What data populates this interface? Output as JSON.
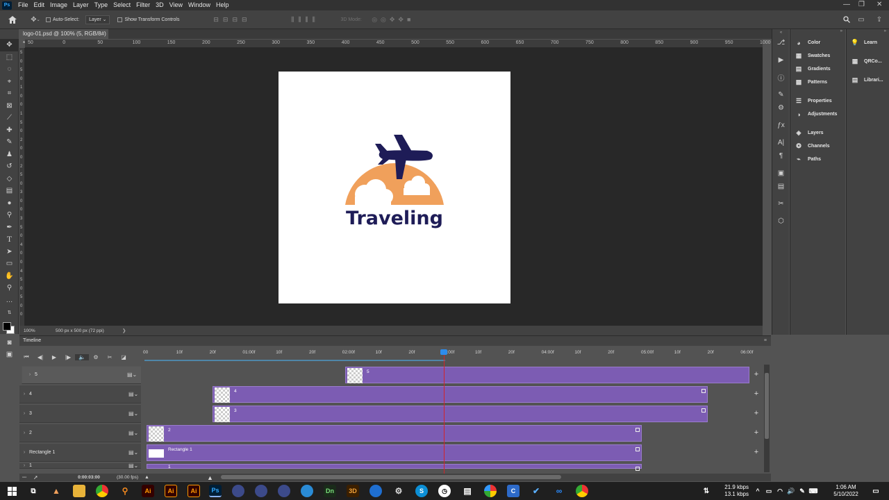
{
  "app": {
    "logo": "Ps",
    "accent": "#31a8ff"
  },
  "menubar": {
    "items": [
      "File",
      "Edit",
      "Image",
      "Layer",
      "Type",
      "Select",
      "Filter",
      "3D",
      "View",
      "Window",
      "Help"
    ],
    "window_controls": [
      "—",
      "❐",
      "✕"
    ]
  },
  "options_bar": {
    "auto_select_label": "Auto-Select:",
    "auto_select_value": "Layer",
    "show_transform_label": "Show Transform Controls",
    "mode_3d_label": "3D Mode:"
  },
  "document": {
    "tab_title": "logo-01.psd @ 100% (5, RGB/8#) *",
    "close_symbol": "×",
    "zoom": "100%",
    "size_info": "500 px x 500 px (72 ppi)",
    "status_arrow": "❯"
  },
  "ruler": {
    "h_labels": [
      "50",
      "0",
      "50",
      "100",
      "150",
      "200",
      "250",
      "300",
      "350",
      "400",
      "450",
      "500",
      "550",
      "600",
      "650",
      "700",
      "750",
      "800",
      "850",
      "900",
      "950",
      "1000"
    ],
    "v_labels": [
      "5",
      "0",
      "5",
      "0",
      "1",
      "0",
      "0",
      "1",
      "5",
      "0",
      "2",
      "0",
      "0",
      "2",
      "5",
      "0",
      "3",
      "0",
      "0",
      "3",
      "5",
      "0",
      "4",
      "0",
      "0",
      "4",
      "5",
      "0",
      "5",
      "0",
      "0"
    ]
  },
  "logo": {
    "text": "Traveling",
    "text_color": "#1e1c57",
    "sun_color": "#f0a05b",
    "plane_color": "#1e1c57"
  },
  "right_panels": {
    "group1": [
      {
        "icon": "color-icon",
        "label": "Color"
      },
      {
        "icon": "swatches-icon",
        "label": "Swatches"
      },
      {
        "icon": "gradients-icon",
        "label": "Gradients"
      },
      {
        "icon": "patterns-icon",
        "label": "Patterns"
      }
    ],
    "group2": [
      {
        "icon": "properties-icon",
        "label": "Properties"
      },
      {
        "icon": "adjustments-icon",
        "label": "Adjustments"
      }
    ],
    "group3": [
      {
        "icon": "layers-icon",
        "label": "Layers"
      },
      {
        "icon": "channels-icon",
        "label": "Channels"
      },
      {
        "icon": "paths-icon",
        "label": "Paths"
      }
    ],
    "col3": [
      {
        "icon": "learn-icon",
        "label": "Learn"
      },
      {
        "icon": "qrcode-icon",
        "label": "QRCo..."
      },
      {
        "icon": "libraries-icon",
        "label": "Librari..."
      }
    ]
  },
  "timeline": {
    "title": "Timeline",
    "ruler_labels": [
      "00",
      "10f",
      "20f",
      "01:00f",
      "10f",
      "20f",
      "02:00f",
      "10f",
      "20f",
      "03:00f",
      "10f",
      "20f",
      "04:00f",
      "10f",
      "20f",
      "05:00f",
      "10f",
      "20f",
      "06:00f"
    ],
    "layers": [
      {
        "label": "5",
        "clip_name": "5"
      },
      {
        "label": "4",
        "clip_name": "4"
      },
      {
        "label": "3",
        "clip_name": "3"
      },
      {
        "label": "2",
        "clip_name": "2"
      },
      {
        "label": "Rectangle 1",
        "clip_name": "Rectangle 1"
      },
      {
        "label": "1",
        "clip_name": "1"
      }
    ],
    "current_time": "0:00:03:00",
    "fps": "(30.00 fps)",
    "clip_color": "#7c5cb3",
    "playhead_color": "#d3232a"
  },
  "taskbar": {
    "net_up": "21.9 kbps",
    "net_down": "13.1 kbps",
    "time": "1:06 AM",
    "date": "5/10/2022",
    "apps": [
      "Ai",
      "Ai",
      "Ai",
      "Ps",
      "Dn",
      "3D"
    ]
  }
}
